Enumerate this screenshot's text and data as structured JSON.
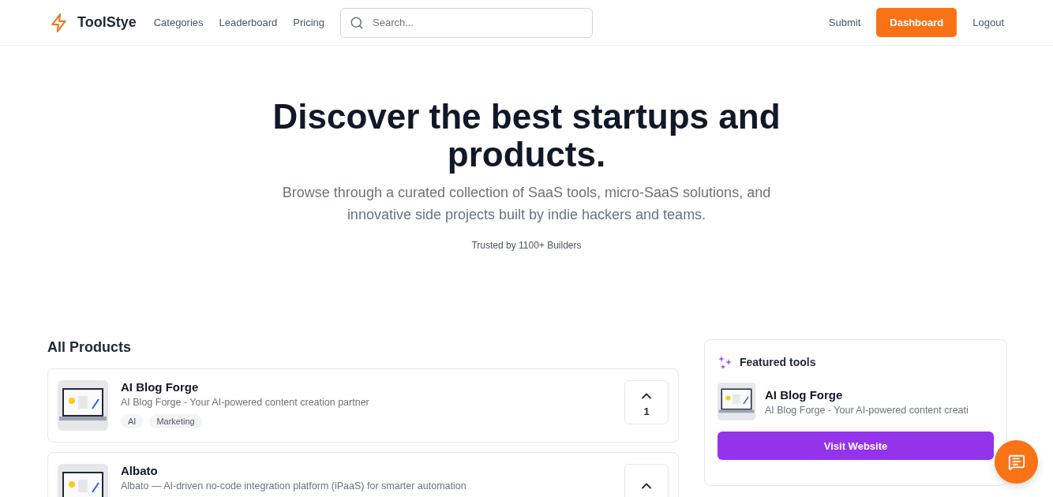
{
  "header": {
    "logo": "ToolStye",
    "nav": [
      "Categories",
      "Leaderboard",
      "Pricing"
    ],
    "search": {
      "placeholder": "Search..."
    },
    "actions": [
      {
        "label": "Submit",
        "kind": "link"
      },
      {
        "label": "Dashboard",
        "kind": "primary"
      },
      {
        "label": "Logout",
        "kind": "link"
      }
    ]
  },
  "hero": {
    "title": "Discover the best startups and products.",
    "subtitle": "Browse through a curated collection of SaaS tools, micro-SaaS solutions, and innovative side projects built by indie hackers and teams.",
    "trust": "Trusted by 1100+ Builders"
  },
  "products": {
    "title": "All Products",
    "items": [
      {
        "name": "AI Blog Forge",
        "description": "AI Blog Forge - Your AI-powered content creation partner",
        "tags": [
          "AI",
          "Marketing"
        ],
        "votes": "1",
        "image": {
          "kind": "picture"
        }
      },
      {
        "name": "Albato",
        "description": "Albato — AI-driven no-code integration platform (iPaaS) for smarter automation",
        "image": {
          "kind": "picture"
        }
      }
    ]
  },
  "featured": {
    "title": "Featured tools",
    "items": [
      {
        "name": "AI Blog Forge",
        "description": "AI Blog Forge - Your AI-powered content creati",
        "button": "Visit Website",
        "image": {
          "kind": "picture"
        }
      }
    ]
  }
}
